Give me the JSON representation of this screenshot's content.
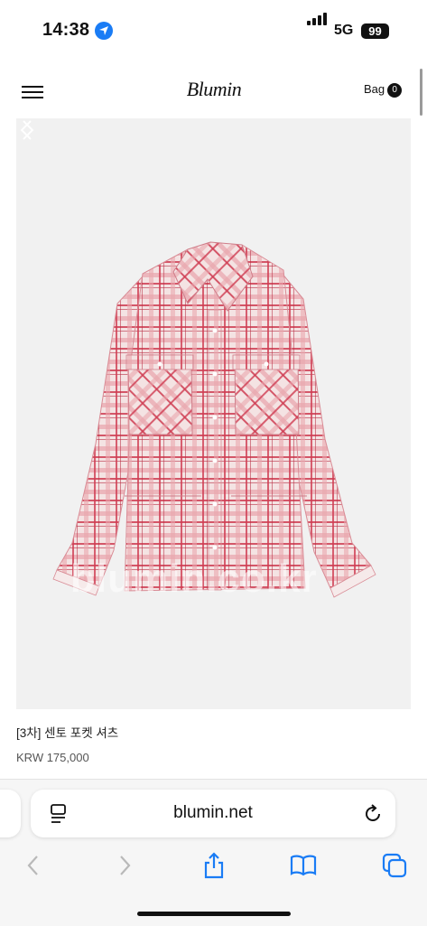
{
  "status_bar": {
    "time": "14:38",
    "network": "5G",
    "battery": "99",
    "signal_bars": 4
  },
  "header": {
    "logo": "Blumin",
    "bag_label": "Bag",
    "bag_count": "0"
  },
  "product": {
    "watermark": "blumin.co.kr",
    "name": "[3차] 센토 포켓 셔츠",
    "price": "KRW 175,000",
    "colors": {
      "shirt_base": "#f4e3e3",
      "check": "#d84a5c",
      "background": "#f1f1f1"
    }
  },
  "browser": {
    "url": "blumin.net"
  },
  "icons": [
    "menu-icon",
    "location-arrow-icon",
    "chevron-left-icon",
    "chevron-right-icon",
    "reader-icon",
    "reload-icon",
    "back-icon",
    "forward-icon",
    "share-icon",
    "bookmarks-icon",
    "tabs-icon"
  ]
}
